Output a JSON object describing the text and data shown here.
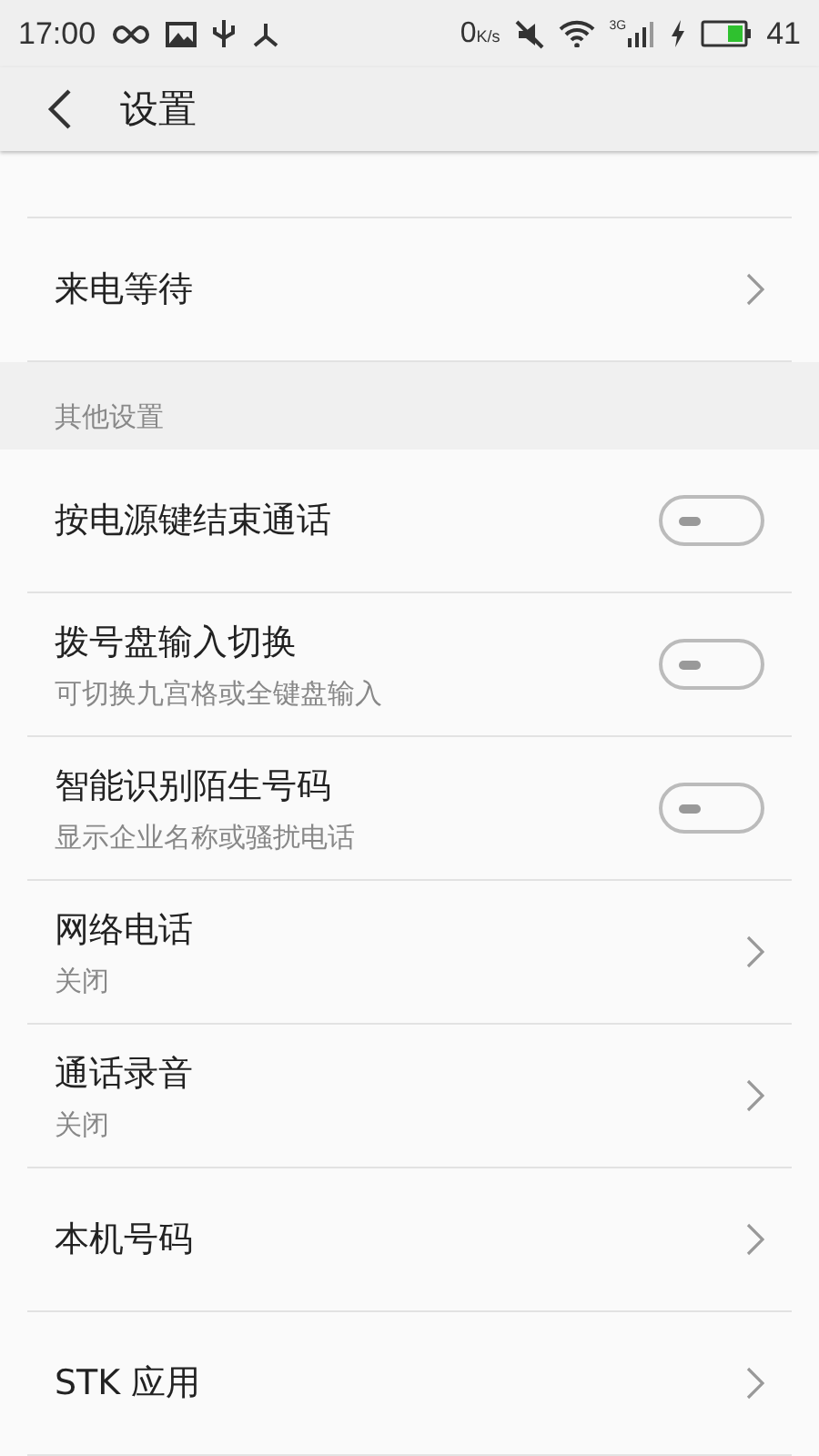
{
  "status_bar": {
    "time": "17:00",
    "speed_value": "0",
    "speed_unit": "K/s",
    "network": "3G",
    "battery_text": "41"
  },
  "header": {
    "title": "设置"
  },
  "rows": [
    {
      "kind": "partial"
    },
    {
      "kind": "link",
      "title": "来电等待"
    },
    {
      "kind": "section",
      "title": "其他设置"
    },
    {
      "kind": "switch",
      "title": "按电源键结束通话",
      "on": false
    },
    {
      "kind": "switch",
      "title": "拨号盘输入切换",
      "subtitle": "可切换九宫格或全键盘输入",
      "on": false
    },
    {
      "kind": "switch",
      "title": "智能识别陌生号码",
      "subtitle": "显示企业名称或骚扰电话",
      "on": false
    },
    {
      "kind": "link",
      "title": "网络电话",
      "subtitle": "关闭"
    },
    {
      "kind": "link",
      "title": "通话录音",
      "subtitle": "关闭"
    },
    {
      "kind": "link",
      "title": "本机号码"
    },
    {
      "kind": "link",
      "title": "STK 应用"
    }
  ]
}
